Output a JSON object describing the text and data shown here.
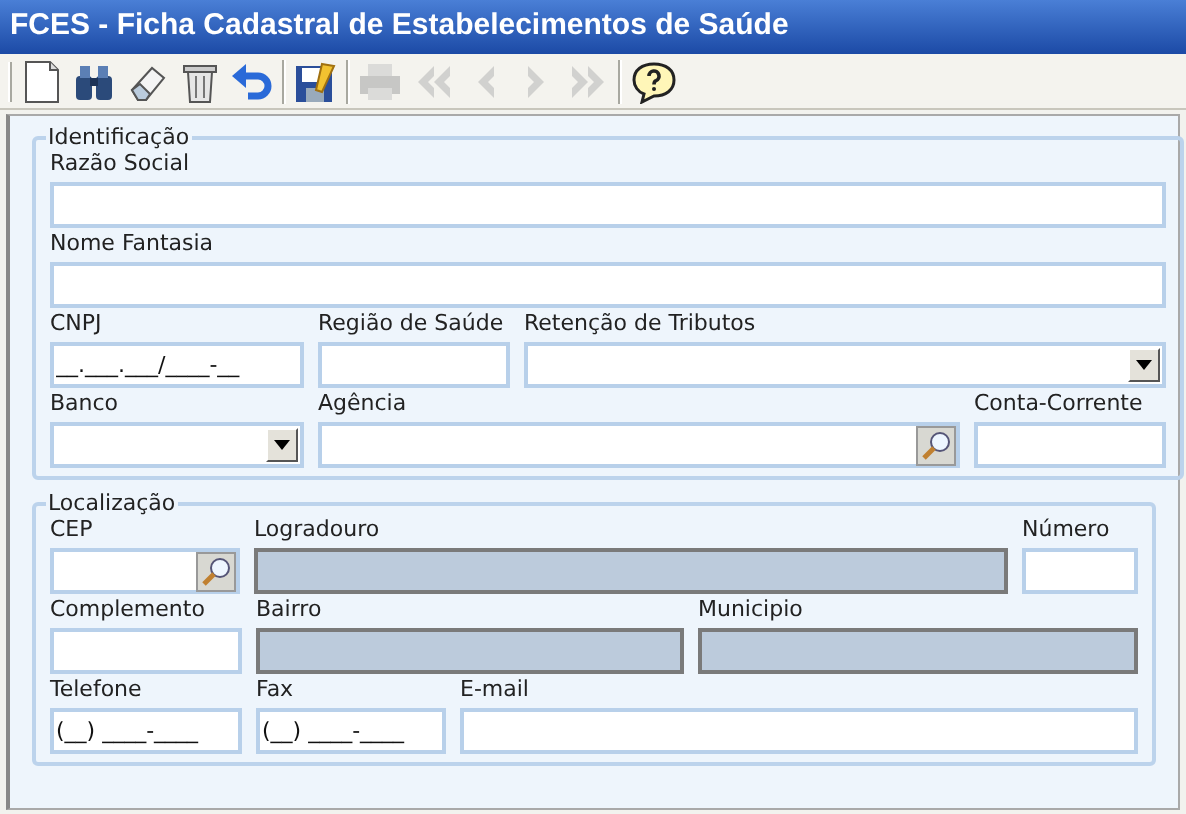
{
  "window": {
    "title": "FCES - Ficha Cadastral de Estabelecimentos de Saúde"
  },
  "toolbar": [
    {
      "kind": "grip"
    },
    {
      "kind": "new",
      "disabled": false
    },
    {
      "kind": "find",
      "disabled": false
    },
    {
      "kind": "erase",
      "disabled": false
    },
    {
      "kind": "delete",
      "disabled": false
    },
    {
      "kind": "undo",
      "disabled": false
    },
    {
      "kind": "separator"
    },
    {
      "kind": "save",
      "disabled": false
    },
    {
      "kind": "separator"
    },
    {
      "kind": "print",
      "disabled": true
    },
    {
      "kind": "first",
      "disabled": true
    },
    {
      "kind": "prev",
      "disabled": true
    },
    {
      "kind": "next",
      "disabled": true
    },
    {
      "kind": "last",
      "disabled": true
    },
    {
      "kind": "separator"
    },
    {
      "kind": "help",
      "disabled": false
    }
  ],
  "sections": [
    {
      "legend": "Identificação",
      "rows": [
        [
          {
            "label": "Razão Social",
            "kind": "text",
            "disabled": false
          }
        ],
        [
          {
            "label": "Nome Fantasia",
            "kind": "text",
            "disabled": false
          }
        ],
        [
          {
            "label": "CNPJ",
            "kind": "text",
            "disabled": false,
            "value": "__.___.___/____-__"
          },
          {
            "label": "Região de Saúde",
            "kind": "text",
            "disabled": false
          },
          {
            "label": "Retenção de Tributos",
            "kind": "select",
            "disabled": false
          }
        ],
        [
          {
            "label": "Banco",
            "kind": "select",
            "disabled": false
          },
          {
            "label": "Agência",
            "kind": "search",
            "disabled": false
          },
          {
            "label": "Conta-Corrente",
            "kind": "text",
            "disabled": false
          }
        ]
      ]
    },
    {
      "legend": "Localização",
      "rows": [
        [
          {
            "label": "CEP",
            "kind": "search",
            "disabled": false
          },
          {
            "label": "Logradouro",
            "kind": "text",
            "disabled": true
          },
          {
            "label": "Número",
            "kind": "text",
            "disabled": false
          }
        ],
        [
          {
            "label": "Complemento",
            "kind": "text",
            "disabled": false
          },
          {
            "label": "Bairro",
            "kind": "text",
            "disabled": true
          },
          {
            "label": "Municipio",
            "kind": "text",
            "disabled": true
          }
        ],
        [
          {
            "label": "Telefone",
            "kind": "text",
            "disabled": false,
            "value": "(__) ____-____"
          },
          {
            "label": "Fax",
            "kind": "text",
            "disabled": false,
            "value": "(__) ____-____"
          },
          {
            "label": "E-mail",
            "kind": "text",
            "disabled": false
          }
        ]
      ]
    }
  ]
}
